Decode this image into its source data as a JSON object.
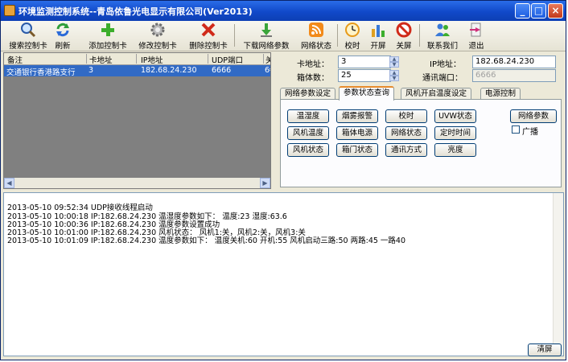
{
  "window": {
    "title": "环境监测控制系统--青岛依鲁光电显示有限公司(Ver2013)",
    "min": "_",
    "max": "□",
    "close": "×"
  },
  "toolbar": {
    "search": "搜索控制卡",
    "refresh": "刷新",
    "add": "添加控制卡",
    "edit": "修改控制卡",
    "delete": "删除控制卡",
    "download": "下载网络参数",
    "netstatus": "网络状态",
    "sync": "校时",
    "screen_on": "开屏",
    "screen_off": "关屏",
    "contact": "联系我们",
    "exit": "退出"
  },
  "card_list": {
    "columns": [
      "备注",
      "卡地址",
      "IP地址",
      "UDP端口",
      "关"
    ],
    "rows": [
      [
        "交通银行香港路支行",
        "3",
        "182.68.24.230",
        "6666",
        "6€"
      ]
    ]
  },
  "form": {
    "card_addr_label": "卡地址：",
    "card_addr": "3",
    "box_count_label": "箱体数：",
    "box_count": "25",
    "ip_label": "IP地址：",
    "ip": "182.68.24.230",
    "port_label": "通讯端口：",
    "port": "6666"
  },
  "tabs": [
    "网络参数设定",
    "参数状态查询",
    "风机开启温度设定",
    "电源控制"
  ],
  "query_buttons": [
    "温湿度",
    "烟雾报警",
    "校时",
    "UVW状态",
    "风机温度",
    "箱体电源",
    "网络状态",
    "定时时间",
    "风机状态",
    "箱门状态",
    "通讯方式",
    "亮度"
  ],
  "side": {
    "net_params": "网络参数",
    "broadcast": "广播"
  },
  "log": [
    "2013-05-10 09:52:34 UDP接收线程启动",
    "2013-05-10 10:00:18 IP:182.68.24.230 温湿度参数如下： 温度:23 湿度:63.6",
    "2013-05-10 10:00:36 IP:182.68.24.230 温度参数设置成功",
    "2013-05-10 10:01:00 IP:182.68.24.230 风机状态： 风机1:关，风机2:关，风机3:关",
    "2013-05-10 10:01:09 IP:182.68.24.230 温度参数如下： 温度关机:60 开机:55 风机启动三路:50 两路:45 一路40"
  ],
  "clear_label": "清屏"
}
